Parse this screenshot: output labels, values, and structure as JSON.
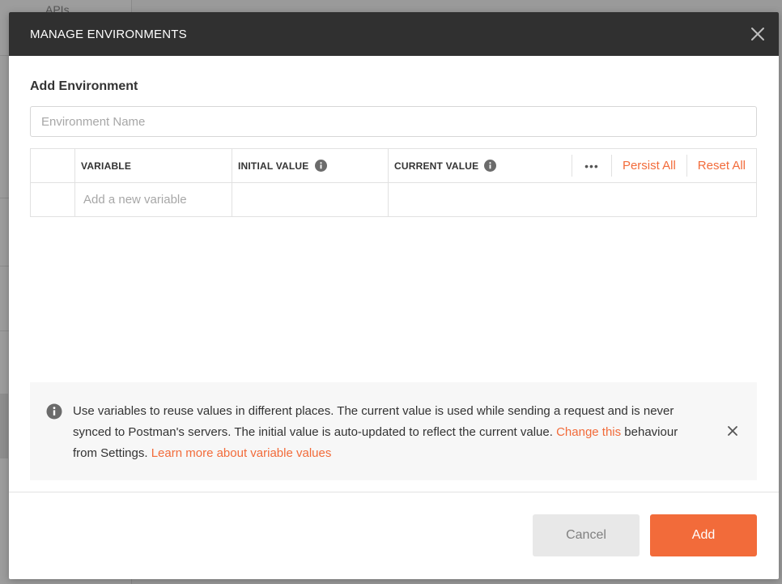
{
  "background": {
    "sidebar_label": "APIs"
  },
  "modal": {
    "title": "MANAGE ENVIRONMENTS",
    "section_title": "Add Environment",
    "environment_name_placeholder": "Environment Name",
    "table": {
      "headers": {
        "variable": "VARIABLE",
        "initial_value": "INITIAL VALUE",
        "current_value": "CURRENT VALUE"
      },
      "actions": {
        "more": "•••",
        "persist_all": "Persist All",
        "reset_all": "Reset All"
      },
      "new_variable_placeholder": "Add a new variable"
    },
    "notice": {
      "text_part1": "Use variables to reuse values in different places. The current value is used while sending a request and is never synced to Postman's servers. The initial value is auto-updated to reflect the current value. ",
      "link_change": "Change this",
      "text_part2": " behaviour from Settings. ",
      "link_learn": "Learn more about variable values"
    },
    "buttons": {
      "cancel": "Cancel",
      "add": "Add"
    }
  },
  "colors": {
    "accent": "#f26b3a",
    "header_bg": "#303030",
    "notice_bg": "#f7f7f7"
  }
}
